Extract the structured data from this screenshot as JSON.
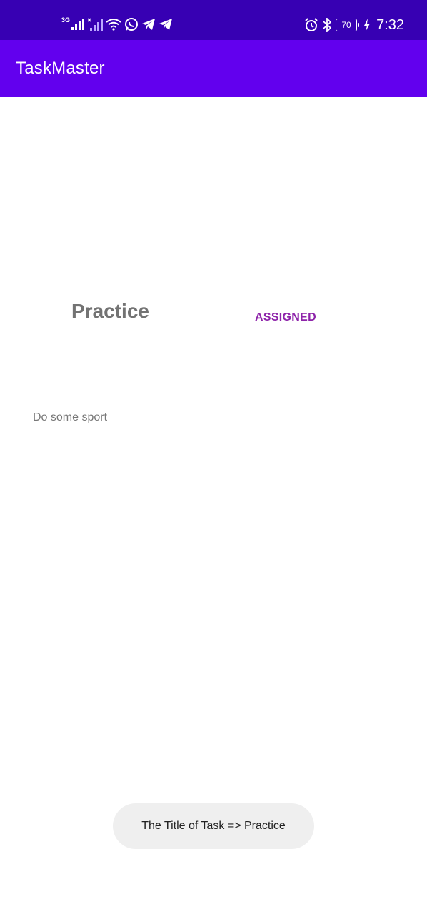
{
  "status_bar": {
    "network_label": "3G",
    "battery": "70",
    "time": "7:32",
    "icons_left": [
      "signal-icon",
      "signal-x-icon",
      "wifi-icon",
      "whatsapp-icon",
      "telegram-icon",
      "telegram-icon"
    ],
    "icons_right": [
      "alarm-icon",
      "bluetooth-icon",
      "battery-icon",
      "charging-icon"
    ],
    "background": "#3700b3"
  },
  "app_bar": {
    "title": "TaskMaster",
    "background": "#6200ee"
  },
  "task": {
    "title": "Practice",
    "state": "ASSIGNED",
    "body": "Do some sport",
    "state_color": "#8e24aa"
  },
  "toast": {
    "message": "The Title of Task => Practice"
  }
}
